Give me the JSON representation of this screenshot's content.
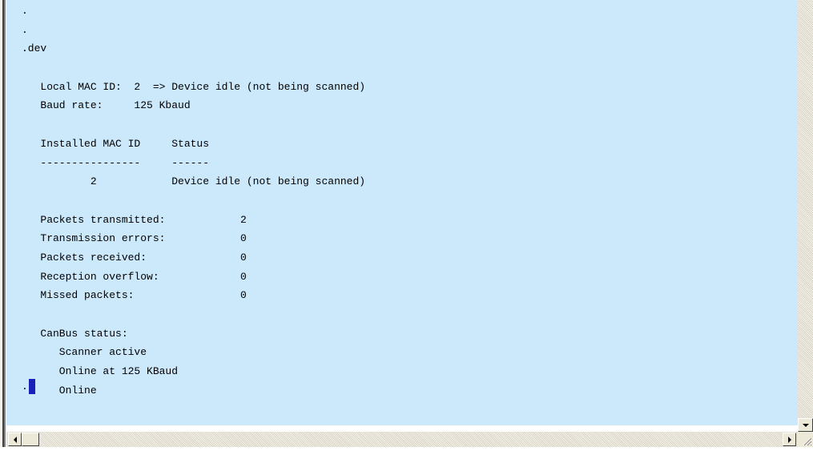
{
  "console": {
    "lines": [
      ".",
      ".",
      ".dev",
      "",
      "   Local MAC ID:  2  => Device idle (not being scanned)",
      "   Baud rate:     125 Kbaud",
      "",
      "   Installed MAC ID     Status",
      "   ----------------     ------",
      "           2            Device idle (not being scanned)",
      "",
      "   Packets transmitted:            2",
      "   Transmission errors:            0",
      "   Packets received:               0",
      "   Reception overflow:             0",
      "   Missed packets:                 0",
      "",
      "   CanBus status:",
      "      Scanner active",
      "      Online at 125 KBaud",
      "      Online"
    ],
    "prompt": ".",
    "background_color": "#cce8fb",
    "caret_color": "#1a20b8"
  },
  "scrollbars": {
    "vertical_down_icon": "triangle-down-icon",
    "horizontal_left_icon": "triangle-left-icon",
    "horizontal_right_icon": "triangle-right-icon",
    "size_grip_icon": "size-grip-icon"
  }
}
